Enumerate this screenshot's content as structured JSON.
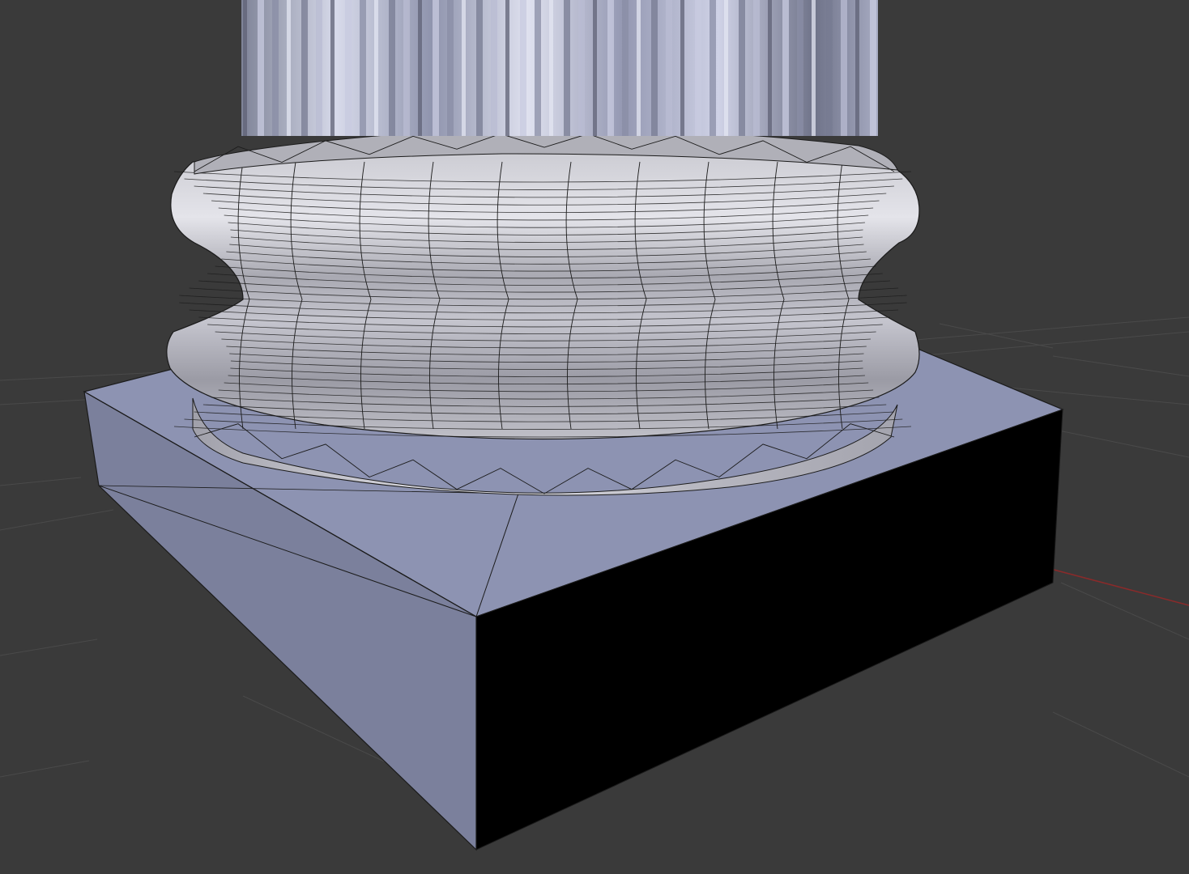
{
  "viewport": {
    "background": "#3a3a3a",
    "grid_color": "#4a4a4a",
    "x_axis_color": "#8a2a2a",
    "shading": "solid-with-wireframe"
  },
  "scene": {
    "objects": [
      {
        "name": "column-shaft",
        "shape": "fluted cylinder",
        "color": "#a9aec4"
      },
      {
        "name": "column-base-torus",
        "shape": "torus",
        "color": "#b5b5bc",
        "wire_color": "#1a1a1a"
      },
      {
        "name": "base-ring-lower",
        "shape": "beveled ring",
        "color": "#c4c4cc"
      },
      {
        "name": "base-ring-upper",
        "shape": "beveled ring",
        "color": "#b0b0b8"
      },
      {
        "name": "plinth",
        "shape": "box",
        "top_color": "#8d93b2",
        "front_color": "#7b809c",
        "side_color": "#000000"
      }
    ]
  }
}
